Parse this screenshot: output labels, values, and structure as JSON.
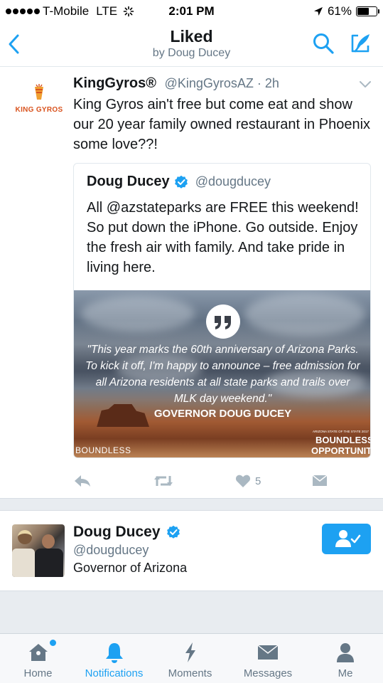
{
  "status_bar": {
    "carrier": "T-Mobile",
    "network": "LTE",
    "time": "2:01 PM",
    "battery": "61%",
    "battery_level": 0.61
  },
  "nav": {
    "title": "Liked",
    "subtitle": "by Doug Ducey"
  },
  "tweet": {
    "author_name": "KingGyros®",
    "author_handle": "@KingGyrosAZ",
    "time": "2h",
    "logo_text": "KING GYROS",
    "text": "King Gyros ain't free but come eat and show our 20 year family owned restaurant in Phoenix some love??!",
    "quote": {
      "author_name": "Doug Ducey",
      "author_handle": "@dougducey",
      "text": "All @azstateparks are FREE this weekend! So put down the iPhone. Go outside. Enjoy the fresh air with family. And take pride in living here.",
      "image": {
        "quote_text": "\"This year marks the 60th anniversary of Arizona Parks. To kick it off, I'm happy to announce – free admission for all Arizona residents at all state parks and trails over MLK day weekend.\"",
        "attribution": "GOVERNOR DOUG DUCEY",
        "watermark_left": "BOUNDLESS",
        "small_text": "ARIZONA STATE OF THE STATE 2017",
        "watermark_right_line1": "BOUNDLESS",
        "watermark_right_line2": "OPPORTUNITY"
      }
    },
    "like_count": "5"
  },
  "profile": {
    "name": "Doug Ducey",
    "handle": "@dougducey",
    "bio": "Governor of Arizona"
  },
  "tabs": [
    {
      "label": "Home",
      "icon": "home-icon"
    },
    {
      "label": "Notifications",
      "icon": "bell-icon"
    },
    {
      "label": "Moments",
      "icon": "lightning-icon"
    },
    {
      "label": "Messages",
      "icon": "envelope-icon"
    },
    {
      "label": "Me",
      "icon": "person-icon"
    }
  ],
  "colors": {
    "accent": "#1da1f2",
    "text": "#14171a",
    "muted": "#657786",
    "action_gray": "#aab8c2"
  }
}
